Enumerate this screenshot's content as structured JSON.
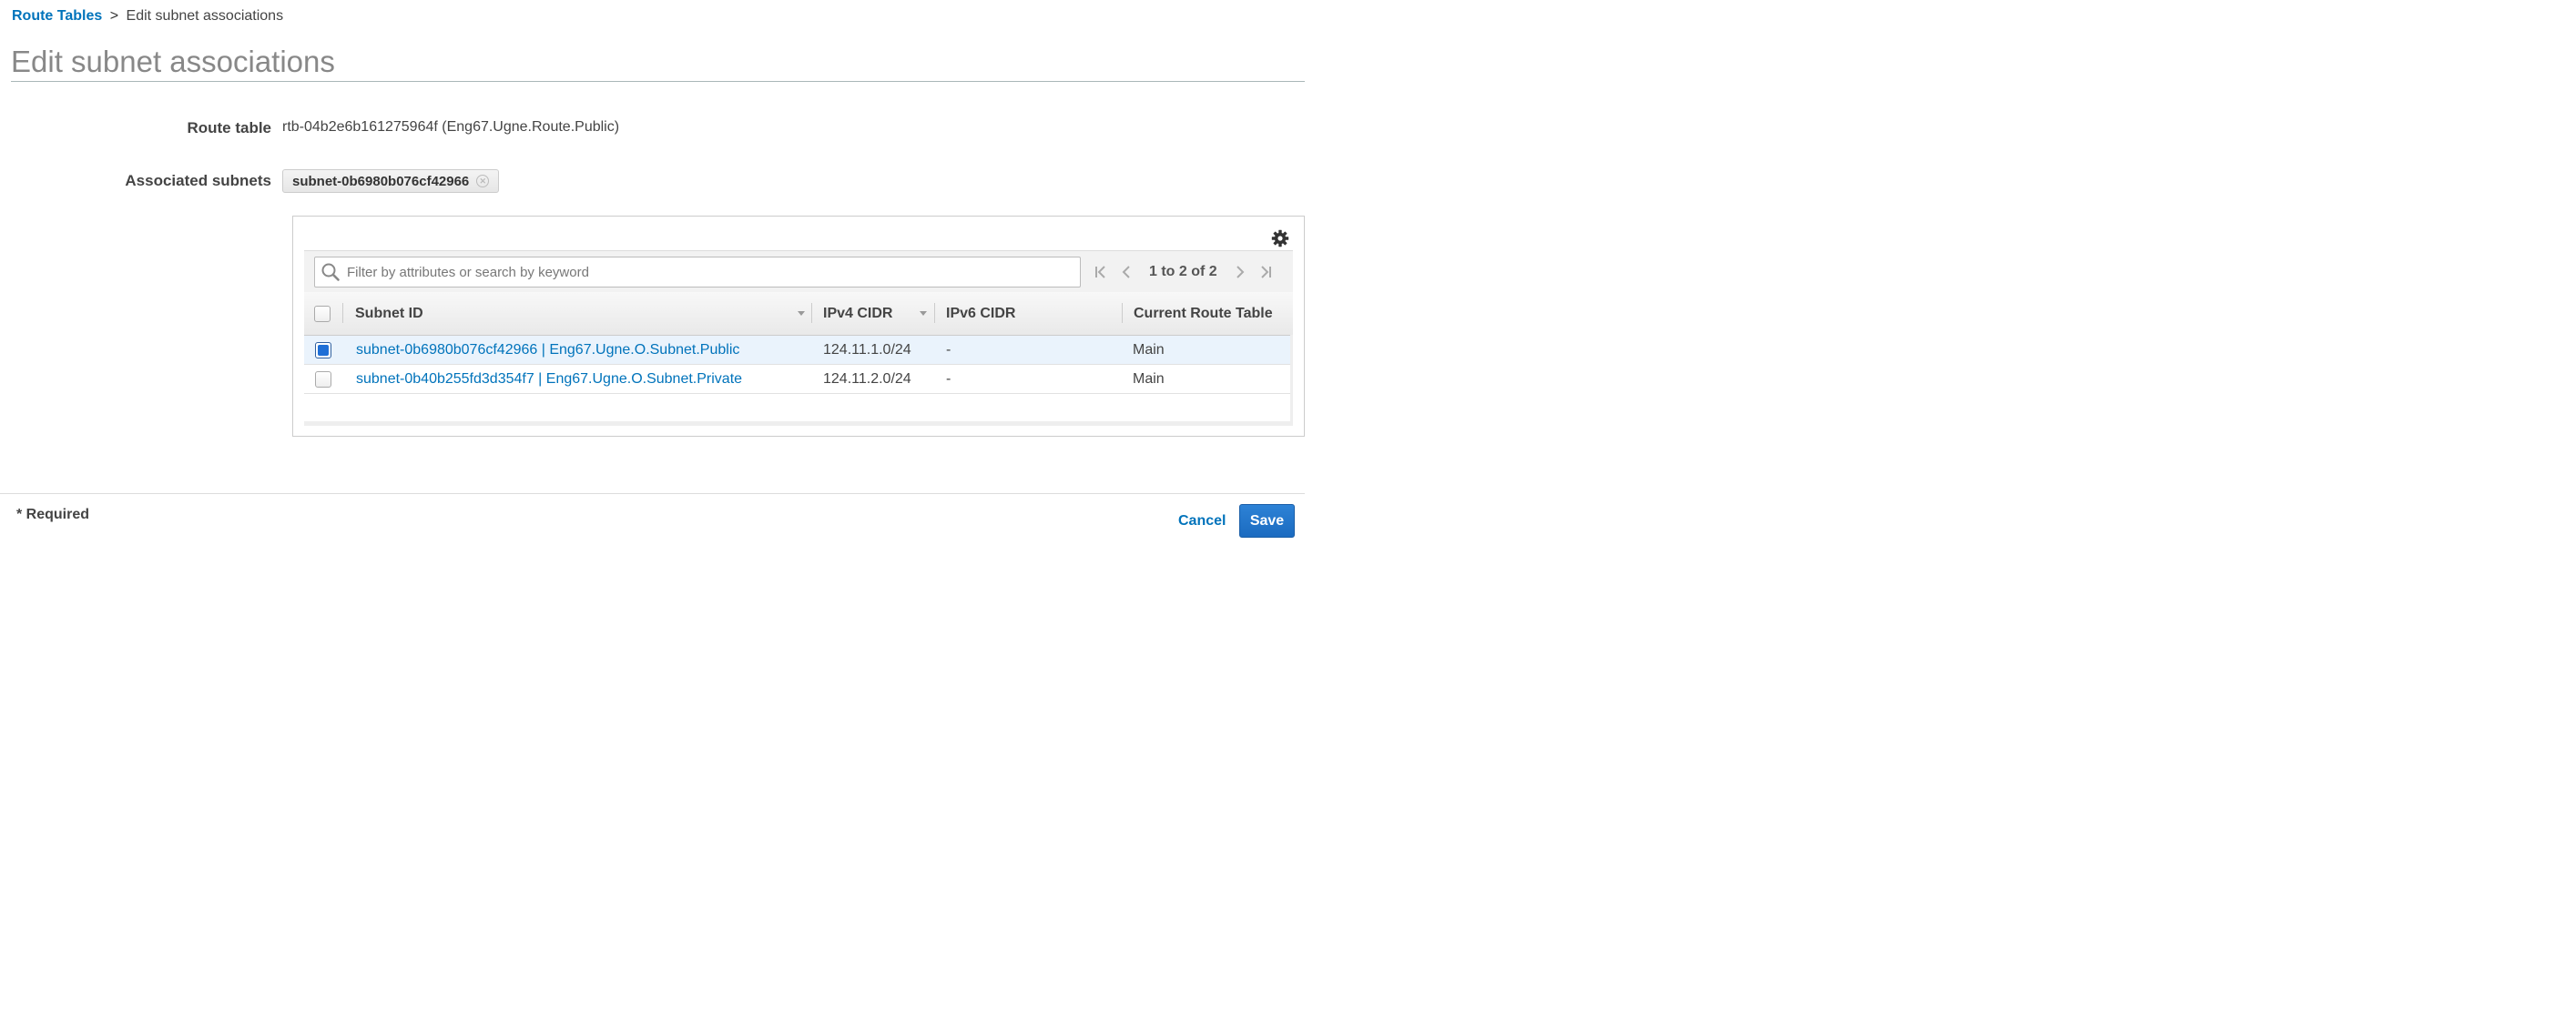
{
  "breadcrumb": {
    "parent": "Route Tables",
    "separator": ">",
    "current": "Edit subnet associations"
  },
  "page_title": "Edit subnet associations",
  "form": {
    "route_table_label": "Route table",
    "route_table_value": "rtb-04b2e6b161275964f (Eng67.Ugne.Route.Public)",
    "associated_subnets_label": "Associated subnets",
    "associated_subnet_tokens": [
      "subnet-0b6980b076cf42966"
    ]
  },
  "table": {
    "search_placeholder": "Filter by attributes or search by keyword",
    "pagination": "1 to 2 of 2",
    "columns": [
      "Subnet ID",
      "IPv4 CIDR",
      "IPv6 CIDR",
      "Current Route Table"
    ],
    "rows": [
      {
        "selected": true,
        "subnet_id": "subnet-0b6980b076cf42966 | Eng67.Ugne.O.Subnet.Public",
        "ipv4_cidr": "124.11.1.0/24",
        "ipv6_cidr": "-",
        "current_route_table": "Main"
      },
      {
        "selected": false,
        "subnet_id": "subnet-0b40b255fd3d354f7 | Eng67.Ugne.O.Subnet.Private",
        "ipv4_cidr": "124.11.2.0/24",
        "ipv6_cidr": "-",
        "current_route_table": "Main"
      }
    ]
  },
  "footer": {
    "required_note": "* Required",
    "cancel_label": "Cancel",
    "save_label": "Save"
  },
  "icons": {
    "settings": "gear-icon",
    "search": "search-icon",
    "token_remove": "close-circle-icon",
    "first_page": "first-page-icon",
    "previous_page": "chevron-left-icon",
    "next_page": "chevron-right-icon",
    "last_page": "last-page-icon"
  },
  "colors": {
    "link": "#0073bb",
    "primary_button": "#1b6bc0",
    "selected_row": "#eaf3fc",
    "title": "#888888"
  }
}
